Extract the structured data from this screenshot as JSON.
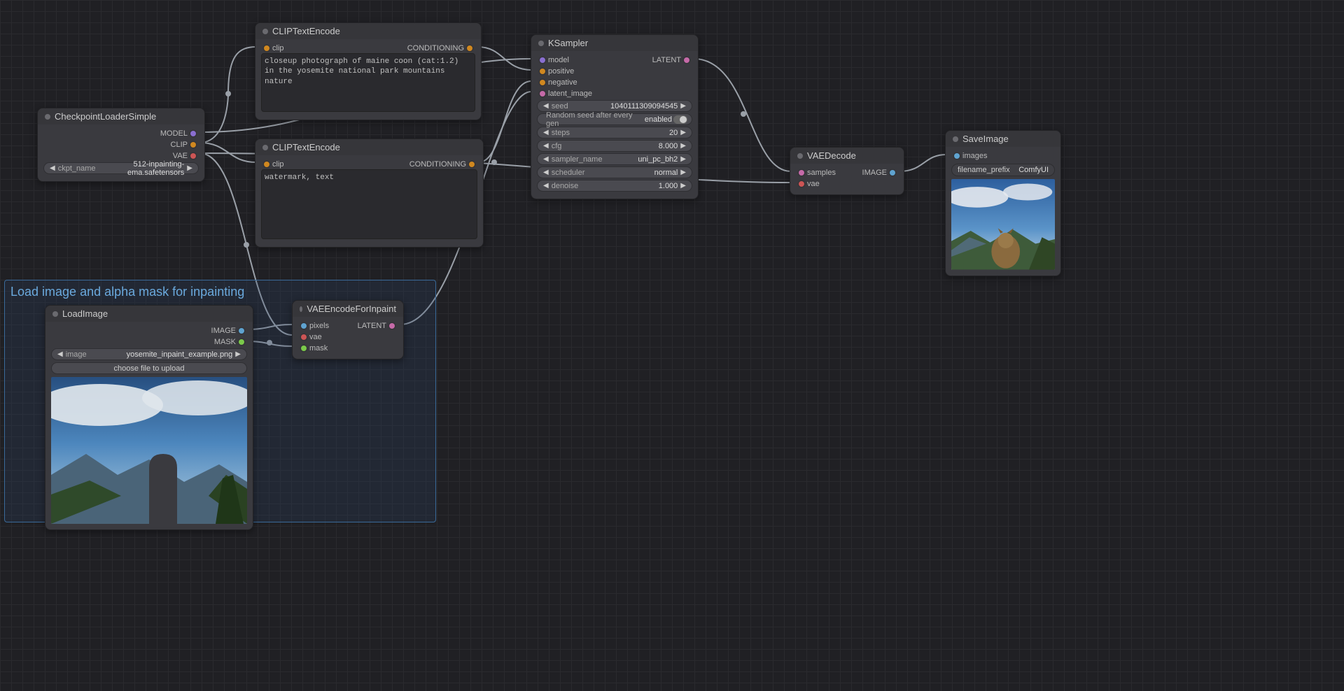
{
  "group": {
    "title": "Load image and alpha mask for inpainting"
  },
  "nodes": {
    "ckpt_loader": {
      "title": "CheckpointLoaderSimple",
      "outputs": {
        "model": "MODEL",
        "clip": "CLIP",
        "vae": "VAE"
      },
      "widgets": {
        "ckpt_name_label": "ckpt_name",
        "ckpt_name_value": "512-inpainting-ema.safetensors"
      }
    },
    "clip_pos": {
      "title": "CLIPTextEncode",
      "inputs": {
        "clip": "clip"
      },
      "outputs": {
        "conditioning": "CONDITIONING"
      },
      "text": "closeup photograph of maine coon (cat:1.2) in the yosemite national park mountains nature"
    },
    "clip_neg": {
      "title": "CLIPTextEncode",
      "inputs": {
        "clip": "clip"
      },
      "outputs": {
        "conditioning": "CONDITIONING"
      },
      "text": "watermark, text"
    },
    "ksampler": {
      "title": "KSampler",
      "inputs": {
        "model": "model",
        "positive": "positive",
        "negative": "negative",
        "latent_image": "latent_image"
      },
      "outputs": {
        "latent": "LATENT"
      },
      "widgets": {
        "seed_label": "seed",
        "seed_value": "1040111309094545",
        "control_label": "Random seed after every gen",
        "control_value": "enabled",
        "steps_label": "steps",
        "steps_value": "20",
        "cfg_label": "cfg",
        "cfg_value": "8.000",
        "sampler_label": "sampler_name",
        "sampler_value": "uni_pc_bh2",
        "scheduler_label": "scheduler",
        "scheduler_value": "normal",
        "denoise_label": "denoise",
        "denoise_value": "1.000"
      }
    },
    "load_image": {
      "title": "LoadImage",
      "outputs": {
        "image": "IMAGE",
        "mask": "MASK"
      },
      "widgets": {
        "image_label": "image",
        "image_value": "yosemite_inpaint_example.png",
        "upload_label": "choose file to upload"
      }
    },
    "vae_encode": {
      "title": "VAEEncodeForInpaint",
      "inputs": {
        "pixels": "pixels",
        "vae": "vae",
        "mask": "mask"
      },
      "outputs": {
        "latent": "LATENT"
      }
    },
    "vae_decode": {
      "title": "VAEDecode",
      "inputs": {
        "samples": "samples",
        "vae": "vae"
      },
      "outputs": {
        "image": "IMAGE"
      }
    },
    "save_image": {
      "title": "SaveImage",
      "inputs": {
        "images": "images"
      },
      "widgets": {
        "prefix_label": "filename_prefix",
        "prefix_value": "ComfyUI"
      }
    }
  },
  "links_color": "#9aa0a8"
}
